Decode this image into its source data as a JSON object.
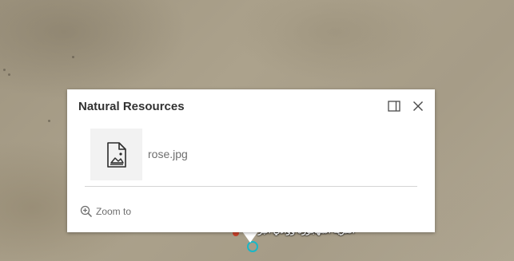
{
  "popup": {
    "title": "Natural Resources",
    "attachment": {
      "file_name": "rose.jpg",
      "icon": "image-file-icon"
    },
    "actions": {
      "zoom_to_label": "Zoom to"
    },
    "dock_icon": "dock-icon",
    "close_icon": "close-icon"
  },
  "map": {
    "feature_label": "ﺍﻟﻘﺮﻳﺔ ﺍﻟﻤﻬﺠﻮﺭﺓ ﻭﻭﺍﺩﻱ ﺍﻟﺒﺮ",
    "colors": {
      "marker": "#19b7c7",
      "label_dot": "#c8402a"
    }
  }
}
